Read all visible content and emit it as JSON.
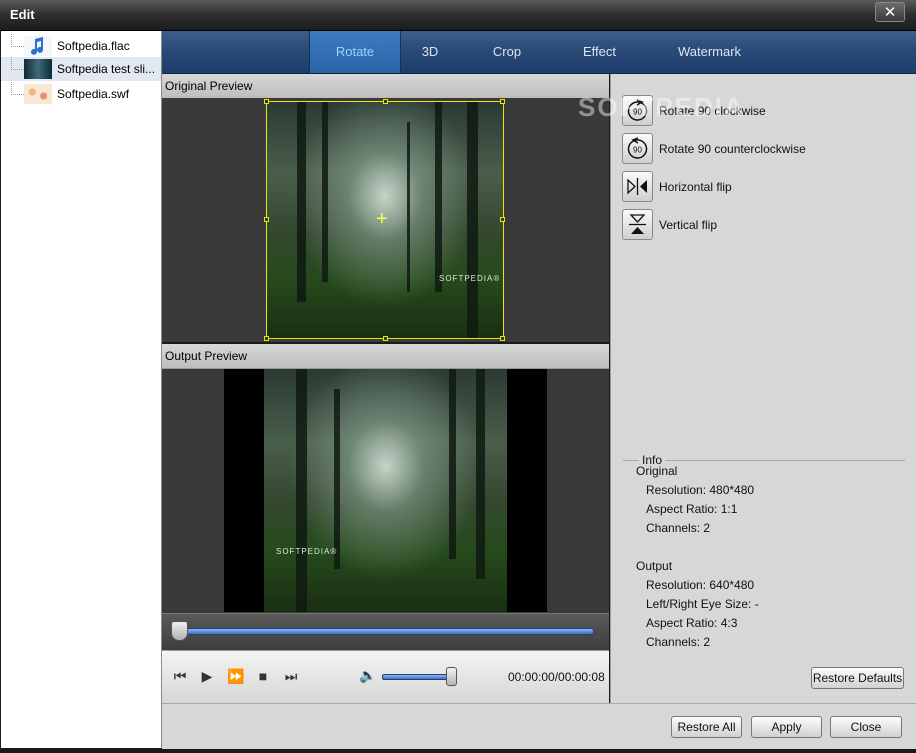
{
  "window": {
    "title": "Edit",
    "close_glyph": "✕"
  },
  "files": [
    {
      "name": "Softpedia.flac",
      "icon": "music-note-icon"
    },
    {
      "name": "Softpedia test sli...",
      "icon": "video-thumbnail"
    },
    {
      "name": "Softpedia.swf",
      "icon": "flash-thumbnail"
    }
  ],
  "tabs": [
    "Rotate",
    "3D",
    "Crop",
    "Effect",
    "Watermark"
  ],
  "active_tab": "Rotate",
  "original_preview": {
    "label": "Original Preview",
    "brand": "SOFTPEDIA®"
  },
  "output_preview": {
    "label": "Output Preview",
    "brand": "SOFTPEDIA®"
  },
  "player": {
    "time": "00:00:00/00:00:08",
    "progress": 0.0,
    "volume": 0.95
  },
  "watermark_text": "SOFTPEDIA",
  "rotate_actions": [
    {
      "label": "Rotate 90 clockwise",
      "icon": "rotate-cw-90-icon",
      "glyph": "90"
    },
    {
      "label": "Rotate 90 counterclockwise",
      "icon": "rotate-ccw-90-icon",
      "glyph": "90"
    },
    {
      "label": "Horizontal flip",
      "icon": "horizontal-flip-icon",
      "glyph": "▷|◁"
    },
    {
      "label": "Vertical flip",
      "icon": "vertical-flip-icon",
      "glyph": "⧖"
    }
  ],
  "info": {
    "caption": "Info",
    "original": {
      "heading": "Original",
      "resolution": "Resolution: 480*480",
      "aspect": "Aspect Ratio: 1:1",
      "channels": "Channels: 2"
    },
    "output": {
      "heading": "Output",
      "resolution": "Resolution: 640*480",
      "eye": "Left/Right Eye Size: -",
      "aspect": "Aspect Ratio: 4:3",
      "channels": "Channels: 2"
    }
  },
  "buttons": {
    "restore_defaults": "Restore Defaults",
    "restore_all": "Restore All",
    "apply": "Apply",
    "close": "Close"
  }
}
